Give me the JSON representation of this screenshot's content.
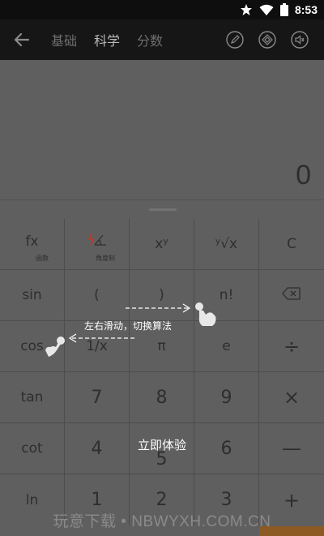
{
  "status_bar": {
    "time": "8:53",
    "icons": [
      "star-icon",
      "wifi-icon",
      "battery-icon"
    ]
  },
  "app_bar": {
    "tabs": [
      {
        "label": "基础",
        "active": false
      },
      {
        "label": "科学",
        "active": true
      },
      {
        "label": "分数",
        "active": false
      }
    ],
    "action_icons": [
      "back-arrow-icon",
      "pencil-icon",
      "diamond-icon",
      "speaker-icon"
    ]
  },
  "display": {
    "result": "0"
  },
  "keypad": {
    "rows": [
      [
        {
          "label": "fx",
          "sub": "函数"
        },
        {
          "label": "",
          "sub": "角度制"
        },
        {
          "label": "xʸ"
        },
        {
          "label": "ʸ√x"
        },
        {
          "label": "C"
        }
      ],
      [
        {
          "label": "sin"
        },
        {
          "label": "("
        },
        {
          "label": ")"
        },
        {
          "label": "n!"
        },
        {
          "label": ""
        }
      ],
      [
        {
          "label": "cos"
        },
        {
          "label": "1/x"
        },
        {
          "label": "π"
        },
        {
          "label": "e"
        },
        {
          "label": "÷"
        }
      ],
      [
        {
          "label": "tan"
        },
        {
          "label": "7"
        },
        {
          "label": "8"
        },
        {
          "label": "9"
        },
        {
          "label": "×"
        }
      ],
      [
        {
          "label": "cot"
        },
        {
          "label": "4"
        },
        {
          "label": "5"
        },
        {
          "label": "6"
        },
        {
          "label": "—"
        }
      ],
      [
        {
          "label": "ln"
        },
        {
          "label": "1"
        },
        {
          "label": "2"
        },
        {
          "label": "3"
        },
        {
          "label": "+"
        }
      ]
    ]
  },
  "overlay": {
    "hint": "左右滑动，切换算法",
    "try_button": "立即体验"
  },
  "watermark": "玩意下载 • NBWYXH.COM.CN",
  "colors": {
    "accent_bar": "#8c5a22",
    "angle_icon_red": "#c0392b"
  }
}
